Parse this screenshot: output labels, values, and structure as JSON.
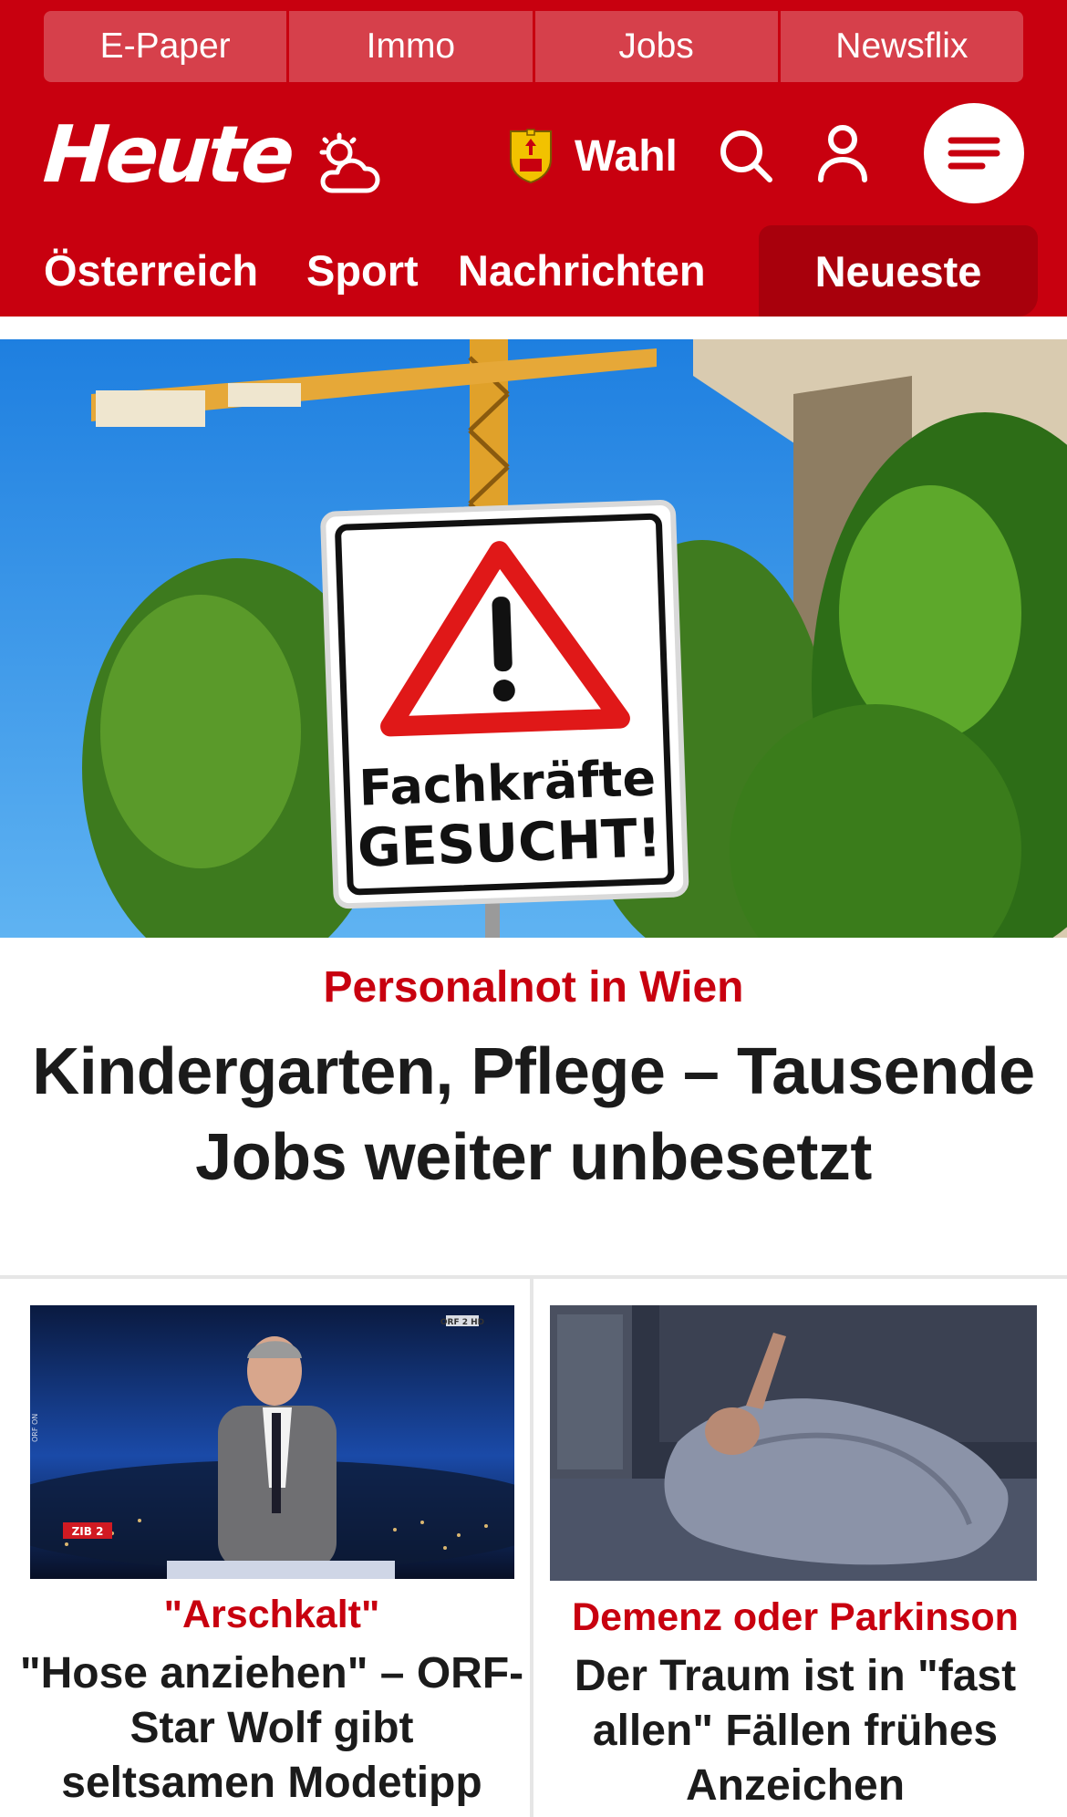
{
  "quick_links": [
    "E-Paper",
    "Immo",
    "Jobs",
    "Newsflix"
  ],
  "brand": {
    "logo": "Heute",
    "election_label": "Wahl"
  },
  "nav": {
    "items": [
      "Österreich",
      "Sport",
      "Nachrichten"
    ],
    "highlight": "Neueste"
  },
  "lead": {
    "kicker": "Personalnot in Wien",
    "title": "Kindergarten, Pflege – Tausende Jobs weiter unbesetzt",
    "sign_line1": "Fachkräfte",
    "sign_line2": "GESUCHT!"
  },
  "teasers": [
    {
      "kicker": "\"Arschkalt\"",
      "title": "\"Hose anziehen\" – ORF-Star Wolf gibt seltsamen Modetipp",
      "channel_badge": "ORF 2 HD",
      "show_badge": "ZIB 2",
      "side_text": "ORF ON"
    },
    {
      "kicker": "Demenz oder Parkinson",
      "title": "Der Traum ist in \"fast allen\" Fällen frühes Anzeichen"
    }
  ],
  "colors": {
    "brand_red": "#c8000f",
    "nav_highlight": "#a8000c",
    "text": "#1b1b1b"
  },
  "icons": [
    "weather-cloud-sun-icon",
    "coat-of-arms-icon",
    "search-icon",
    "user-icon",
    "menu-icon"
  ]
}
